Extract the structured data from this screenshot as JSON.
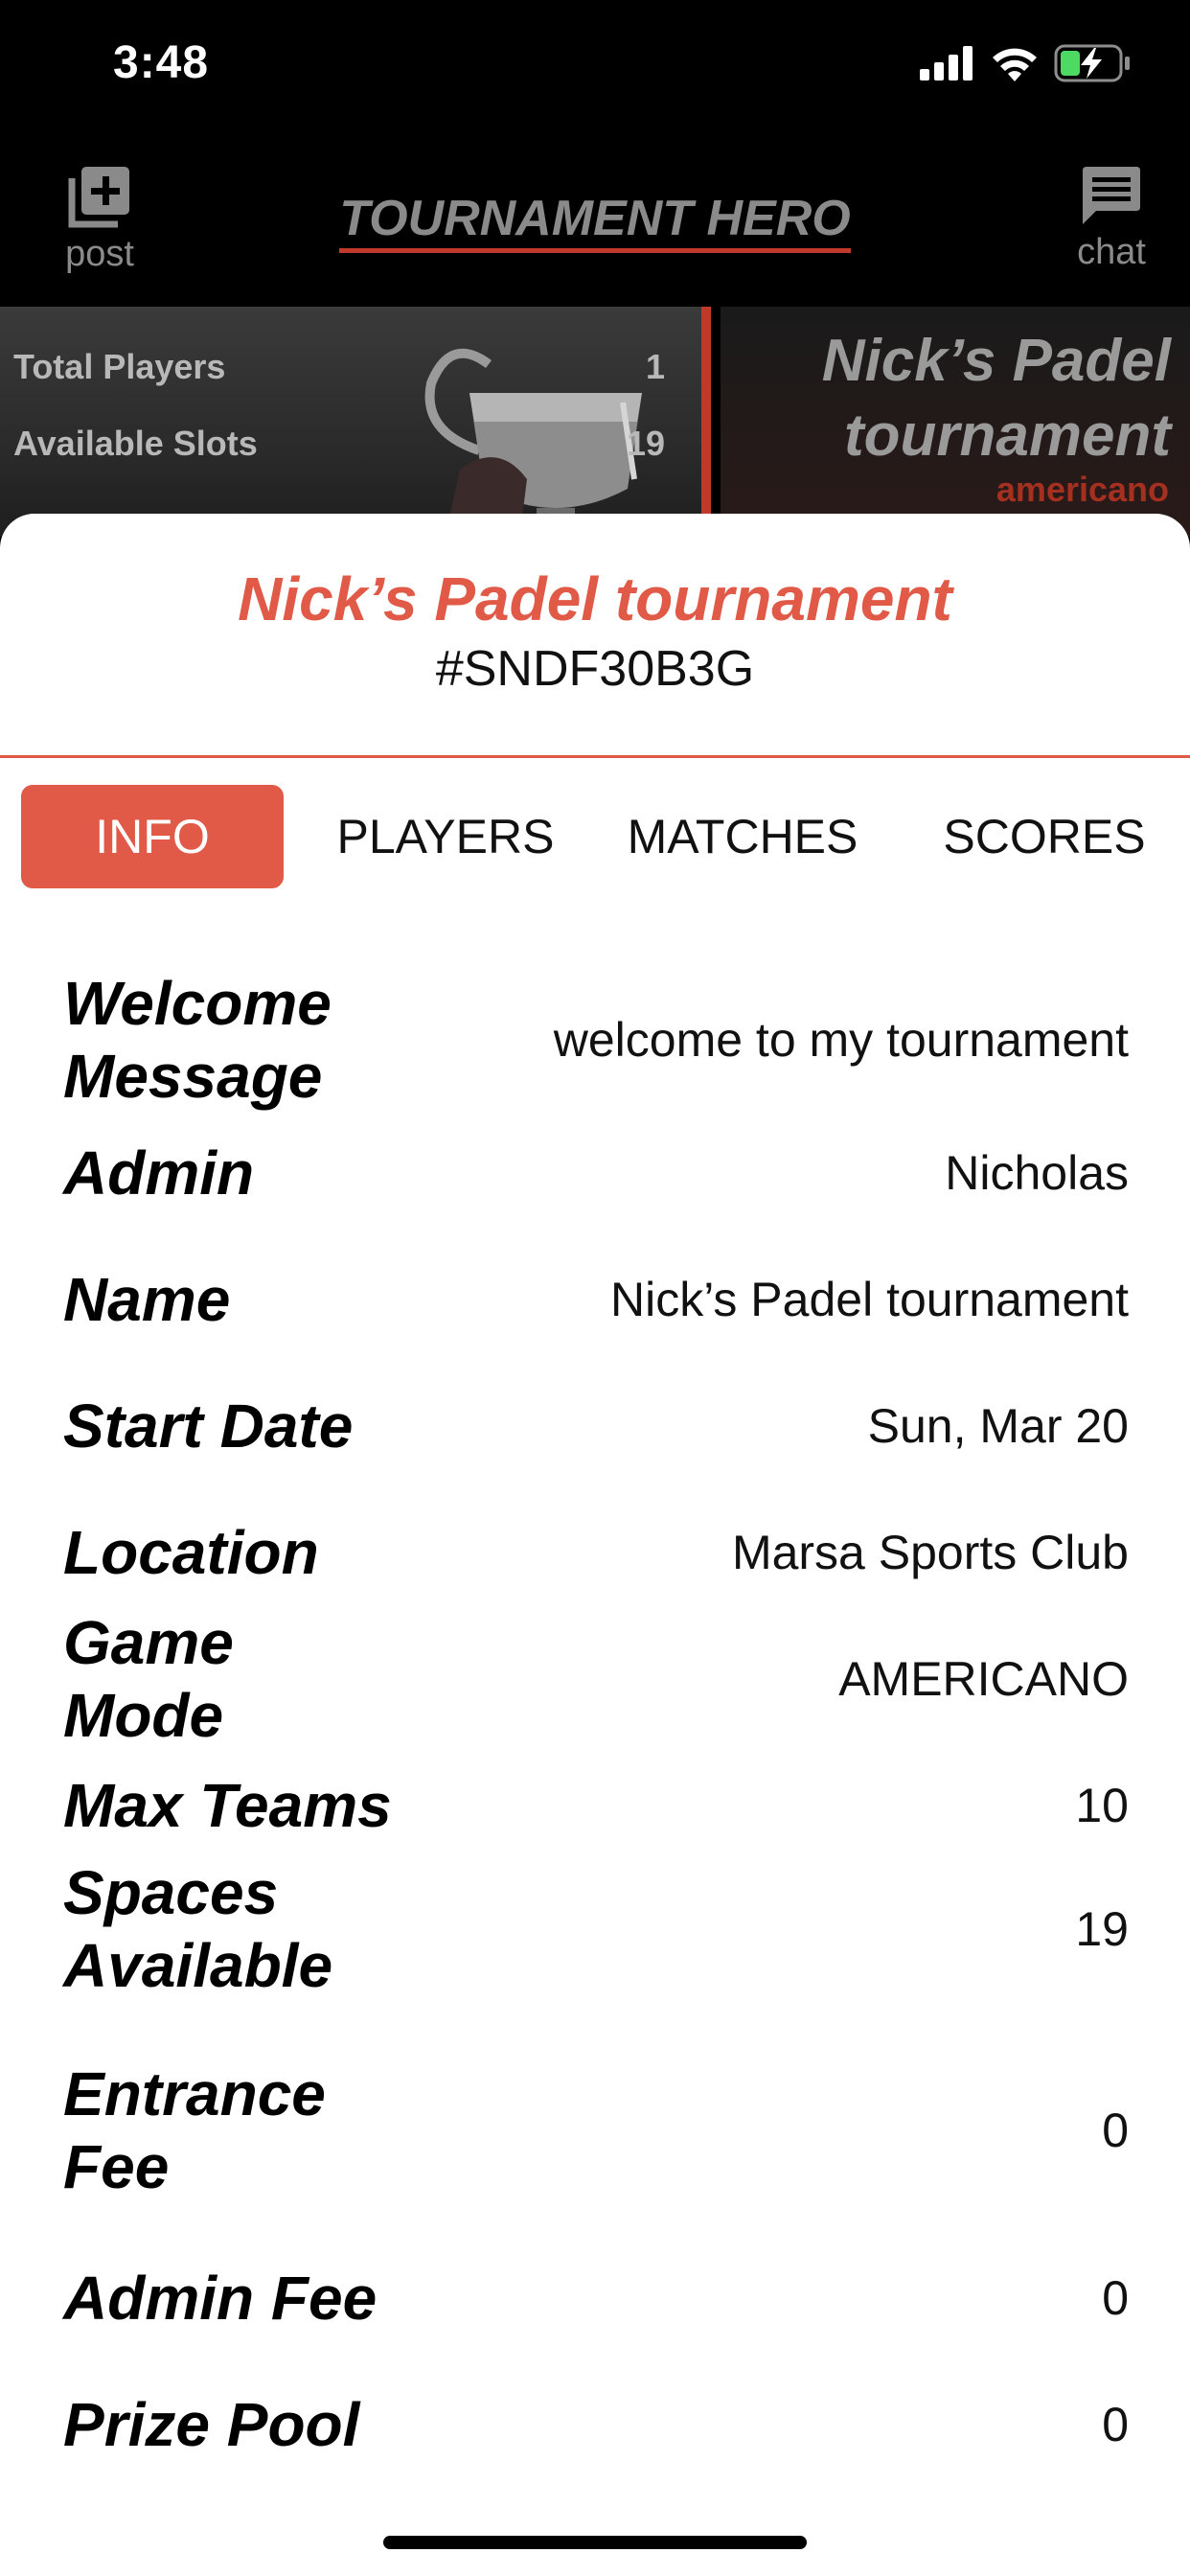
{
  "status_bar": {
    "time": "3:48"
  },
  "header": {
    "title": "TOURNAMENT HERO",
    "post_label": "post",
    "chat_label": "chat"
  },
  "banner": {
    "total_players_label": "Total Players",
    "total_players_value": "1",
    "available_slots_label": "Available Slots",
    "available_slots_value": "19",
    "tournament_name": "Nick’s Padel tournament",
    "mode": "americano"
  },
  "sheet": {
    "title": "Nick’s Padel tournament",
    "code": "#SNDF30B3G",
    "tabs": [
      {
        "label": "INFO",
        "active": true
      },
      {
        "label": "PLAYERS",
        "active": false
      },
      {
        "label": "MATCHES",
        "active": false
      },
      {
        "label": "SCORES",
        "active": false
      }
    ],
    "info": [
      {
        "label": "Welcome Message",
        "value": "welcome to my tournament"
      },
      {
        "label": "Admin",
        "value": "Nicholas"
      },
      {
        "label": "Name",
        "value": "Nick’s Padel tournament"
      },
      {
        "label": "Start Date",
        "value": "Sun, Mar 20"
      },
      {
        "label": "Location",
        "value": "Marsa Sports Club"
      },
      {
        "label": "Game Mode",
        "value": "AMERICANO"
      },
      {
        "label": "Max Teams",
        "value": "10"
      },
      {
        "label": "Spaces Available",
        "value": "19"
      },
      {
        "label": "Entrance Fee",
        "value": "0"
      },
      {
        "label": "Admin Fee",
        "value": "0"
      },
      {
        "label": "Prize Pool",
        "value": "0"
      }
    ]
  },
  "colors": {
    "accent": "#e05a47",
    "accent_dark": "#c0392b",
    "battery_fill": "#4cd964"
  }
}
